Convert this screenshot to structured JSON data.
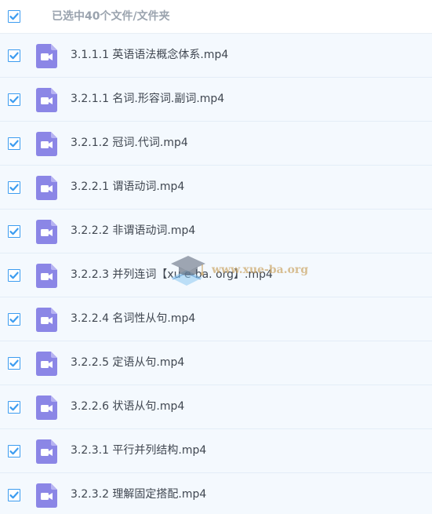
{
  "header": {
    "selection_label": "已选中40个文件/文件夹"
  },
  "colors": {
    "accent": "#3c9cf0",
    "video_icon": "#8b86e6",
    "row_bg": "#f4f9fe"
  },
  "files": [
    {
      "name": "3.1.1.1 英语语法概念体系.mp4",
      "icon": "video-file-icon"
    },
    {
      "name": "3.2.1.1 名词.形容词.副词.mp4",
      "icon": "video-file-icon"
    },
    {
      "name": "3.2.1.2 冠词.代词.mp4",
      "icon": "video-file-icon"
    },
    {
      "name": "3.2.2.1 谓语动词.mp4",
      "icon": "video-file-icon"
    },
    {
      "name": "3.2.2.2 非谓语动词.mp4",
      "icon": "video-file-icon"
    },
    {
      "name": "3.2.2.3 并列连词【xu e-ba. org】.mp4",
      "icon": "video-file-icon"
    },
    {
      "name": "3.2.2.4 名词性从句.mp4",
      "icon": "video-file-icon"
    },
    {
      "name": "3.2.2.5 定语从句.mp4",
      "icon": "video-file-icon"
    },
    {
      "name": "3.2.2.6 状语从句.mp4",
      "icon": "video-file-icon"
    },
    {
      "name": "3.2.3.1 平行并列结构.mp4",
      "icon": "video-file-icon"
    },
    {
      "name": "3.2.3.2 理解固定搭配.mp4",
      "icon": "video-file-icon"
    }
  ],
  "watermark": {
    "text": "www.xue-ba.org"
  }
}
